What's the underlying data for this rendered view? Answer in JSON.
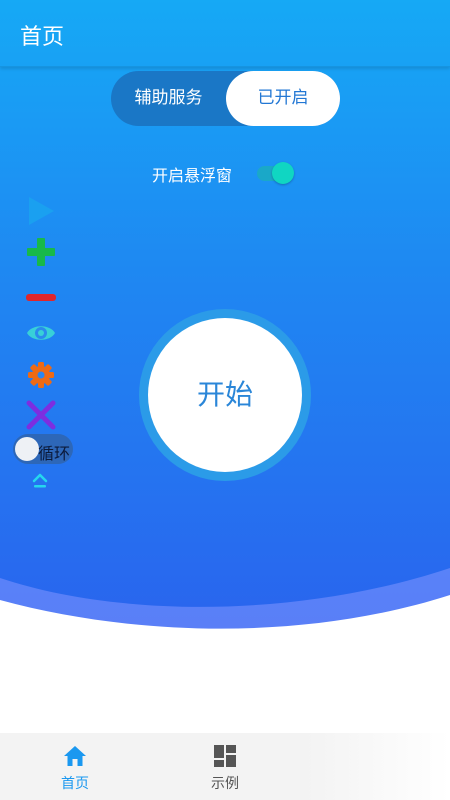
{
  "header": {
    "title": "首页"
  },
  "service_toggle": {
    "left_label": "辅助服务",
    "right_label": "已开启"
  },
  "floating_window": {
    "label": "开启悬浮窗",
    "enabled": true
  },
  "side_toolbar": {
    "icons": [
      "play-icon",
      "plus-icon",
      "minus-icon",
      "eye-icon",
      "gear-icon",
      "close-icon"
    ],
    "loop_label": "循环",
    "loop_enabled": false,
    "collapse_icon": "chevron-up-icon"
  },
  "start_button": {
    "label": "开始"
  },
  "bottom_nav": {
    "items": [
      {
        "label": "首页",
        "icon": "home-icon",
        "active": true
      },
      {
        "label": "示例",
        "icon": "grid-icon",
        "active": false
      }
    ]
  },
  "colors": {
    "primary_blue": "#1a98f0",
    "toggle_accent": "#10d6c2",
    "play": "#1aa0f0",
    "plus": "#18b94a",
    "minus": "#e0262a",
    "eye": "#38d0d8",
    "gear": "#ee6a14",
    "close": "#7d2ee0"
  }
}
